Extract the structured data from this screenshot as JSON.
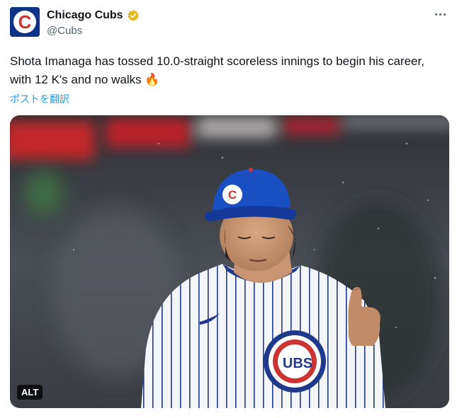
{
  "account": {
    "display_name": "Chicago Cubs",
    "handle": "@Cubs",
    "avatar_letter": "C",
    "verified_icon": "verified-badge-icon"
  },
  "tweet": {
    "text": "Shota Imanaga has tossed 10.0-straight scoreless innings to begin his career, with 12 K's and no walks",
    "emoji": "🔥",
    "translate_label": "ポストを翻訳"
  },
  "media": {
    "alt_label": "ALT",
    "cap_logo_letter": "C",
    "jersey_logo_text": "UBS",
    "jersey_logo_c": "C"
  },
  "colors": {
    "cubs_blue": "#0e3386",
    "cubs_red": "#cc3433",
    "verified_gold": "#e2b719",
    "link_blue": "#1d9bf0"
  }
}
